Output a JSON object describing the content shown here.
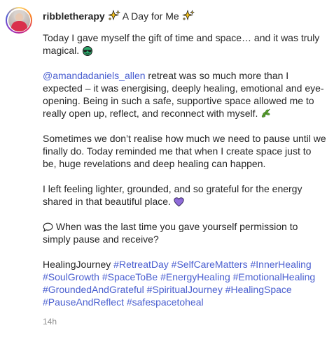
{
  "post": {
    "username": "ribbletherapy",
    "title": "A Day for Me",
    "time": "14h",
    "p1_text": "Today I gave myself the gift of time and space… and it was truly magical.",
    "p2_mention": "@amandadaniels_allen",
    "p2_text": " retreat was so much more than I expected – it was energising, deeply healing, emotional and eye-opening. Being in such a safe, supportive space allowed me to really open up, reflect, and reconnect with myself.",
    "p3_text": "Sometimes we don’t realise how much we need to pause until we finally do. Today reminded me that when I create space just to be, huge revelations and deep healing can happen.",
    "p4_text": "I left feeling lighter, grounded, and so grateful for the energy shared in that beautiful place.",
    "p5_text": " When was the last time you gave yourself permission to simply pause and receive?",
    "tags_first": "HealingJourney ",
    "hashtags": [
      "#RetreatDay",
      "#SelfCareMatters",
      "#InnerHealing",
      "#SoulGrowth",
      "#SpaceToBe",
      "#EnergyHealing",
      "#EmotionalHealing",
      "#GroundedAndGrateful",
      "#SpiritualJourney",
      "#HealingSpace",
      "#PauseAndReflect",
      "#safespacetoheal"
    ],
    "icons": {
      "sparkles": "sparkles-icon",
      "sunglasses": "sunglasses-emoji-icon",
      "herb": "herb-emoji-icon",
      "heart": "purple-heart-emoji-icon",
      "speech": "speech-bubble-icon"
    },
    "colors": {
      "text": "#262626",
      "link": "#4a5fd0",
      "time": "#8e8e8e",
      "heart": "#8e6bd8"
    }
  }
}
